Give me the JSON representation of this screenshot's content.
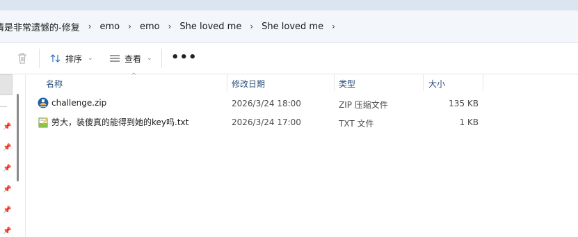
{
  "breadcrumb": [
    "情是非常遗憾的-修复",
    "emo",
    "emo",
    "She loved me",
    "She loved me"
  ],
  "breadcrumb_separator": "›",
  "toolbar": {
    "sort_label": "排序",
    "view_label": "查看",
    "more_label": "•••"
  },
  "columns": {
    "name": "名称",
    "date": "修改日期",
    "type": "类型",
    "size": "大小"
  },
  "files": [
    {
      "name": "challenge.zip",
      "date": "2026/3/24 18:00",
      "type": "ZIP 压缩文件",
      "size": "135 KB",
      "icon": "zip-archive-icon"
    },
    {
      "name": "劳大，装傻真的能得到她的key吗.txt",
      "date": "2026/3/24 17:00",
      "type": "TXT 文件",
      "size": "1 KB",
      "icon": "text-file-icon"
    }
  ],
  "colors": {
    "address_bg": "#f3f6fb",
    "titlebar": "#dbe5f1",
    "header_text": "#2a4d7a"
  }
}
